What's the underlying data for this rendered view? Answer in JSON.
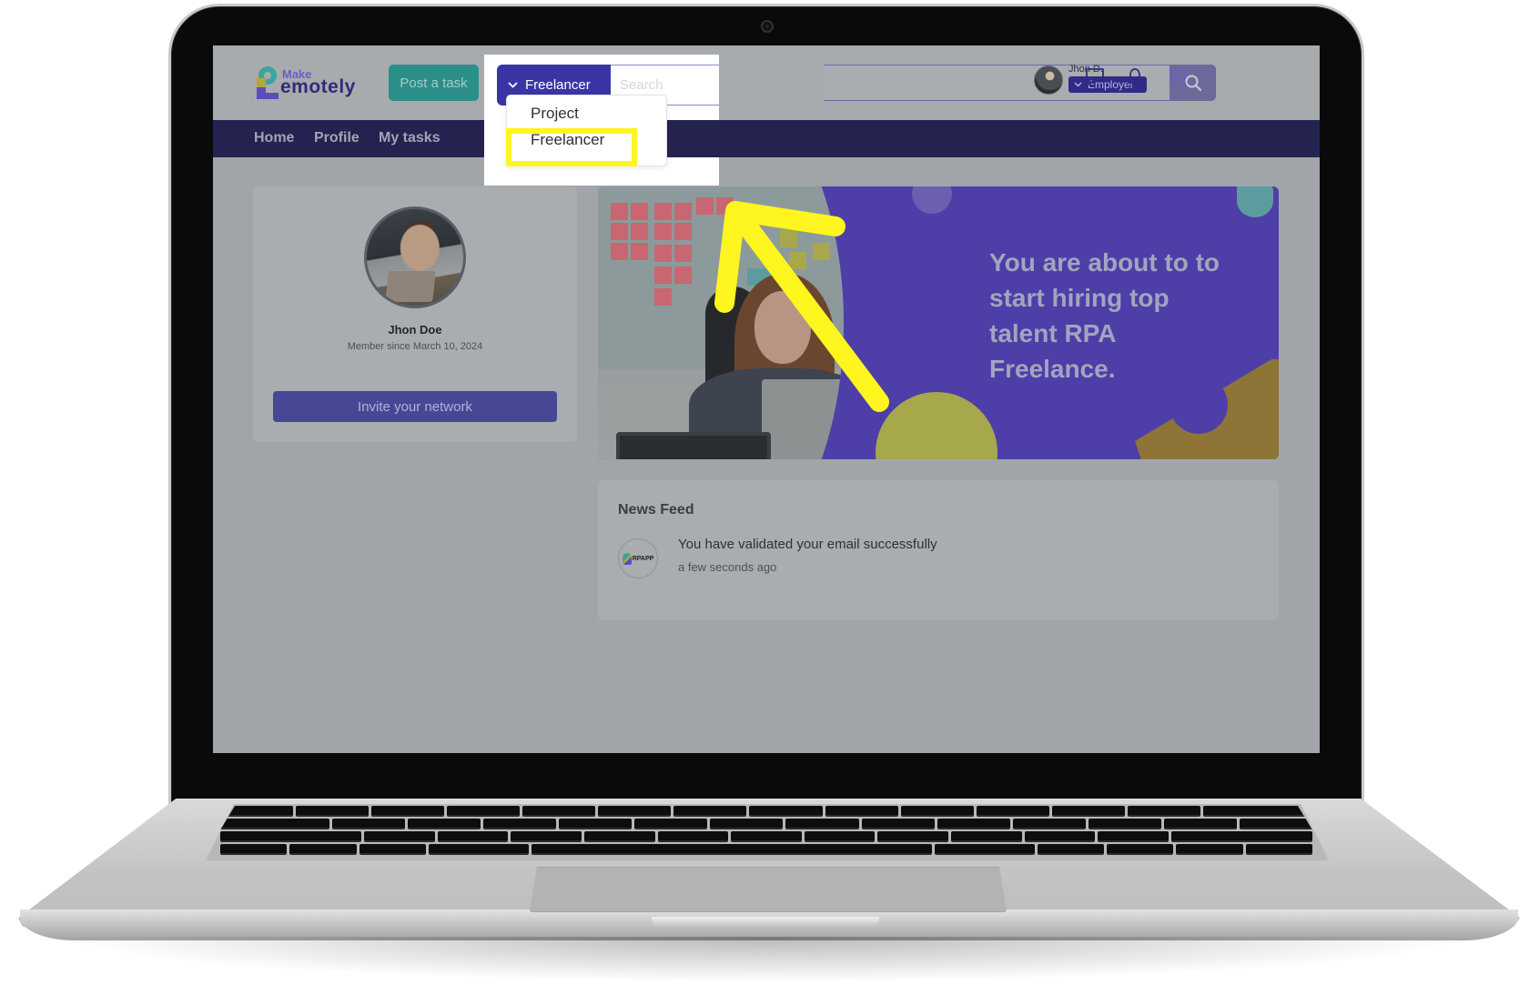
{
  "brand": {
    "logo_top": "Make",
    "logo_word": "emotely"
  },
  "header": {
    "post_task_label": "Post a task",
    "search": {
      "category_selected": "Freelancer",
      "placeholder": "Search",
      "value": ""
    },
    "user": {
      "name": "Jhon D.",
      "role": "Employer"
    },
    "icons": [
      "chat-icon",
      "bell-icon",
      "apps-grid-icon"
    ]
  },
  "dropdown": {
    "options": [
      "Project",
      "Freelancer"
    ],
    "highlighted": "Freelancer"
  },
  "nav": {
    "items": [
      "Home",
      "Profile",
      "My tasks"
    ]
  },
  "profile": {
    "name": "Jhon Doe",
    "member_since": "Member since March 10, 2024",
    "invite_label": "Invite your network"
  },
  "banner": {
    "line1": "You are about to  to",
    "line2": "start hiring top",
    "line3": "talent  RPA",
    "line4": "Freelance."
  },
  "news_feed": {
    "title": "News Feed",
    "items": [
      {
        "source": "RPAPP",
        "text": "You have validated your email successfully",
        "time": "a few seconds ago"
      }
    ]
  },
  "colors": {
    "primary": "#3a35a4",
    "navbar": "#24234f",
    "teal": "#2b8e88",
    "highlight": "#fff51f",
    "banner": "#4e3ea8"
  }
}
